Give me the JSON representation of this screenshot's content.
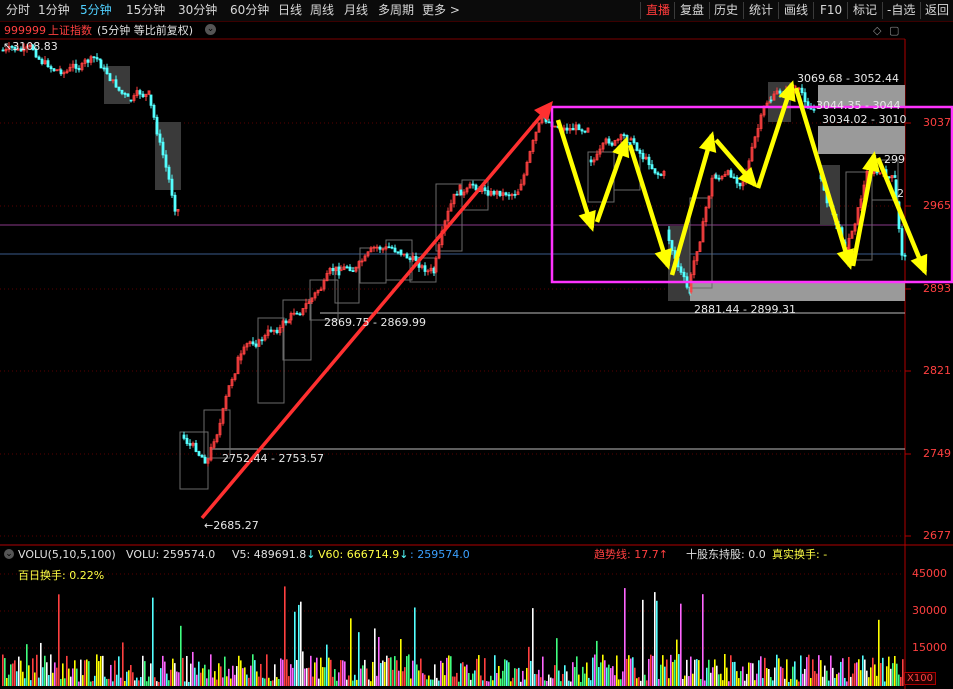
{
  "toolbar": {
    "tabs": [
      "分时",
      "1分钟",
      "5分钟",
      "15分钟",
      "30分钟",
      "60分钟",
      "日线",
      "周线",
      "月线",
      "多周期",
      "更多 >"
    ],
    "active_tab": "5分钟",
    "right": [
      "直播",
      "复盘",
      "历史",
      "统计",
      "画线",
      "F10",
      "标记",
      "-自选",
      "返回"
    ]
  },
  "title": {
    "code": "999999",
    "name": "上证指数",
    "mode": "(5分钟 等比前复权)"
  },
  "price_axis": [
    "3037",
    "2965",
    "2893",
    "2821",
    "2749",
    "2677"
  ],
  "annotations": {
    "high_left": "3108.83",
    "low": "2685.27",
    "zone_2752": "2752.44 - 2753.57",
    "zone_2869": "2869.75 - 2869.99",
    "zone_2881": "2881.44 - 2899.31",
    "zone_3069": "3069.68 - 3052.44",
    "zone_3044": "3044.35 - 3044",
    "zone_3034": "3034.02 - 3010",
    "right_299": "299",
    "right_2": "2"
  },
  "volume_panel": {
    "indicator": "VOLU(5,10,5,100)",
    "volu": "VOLU: 259574.0",
    "v5": "V5: 489691.8",
    "v60": "V60: 666714.9",
    "last": ": 259574.0",
    "trend": "趋势线: 17.7",
    "holders": "十股东持股: 0.0",
    "real_turnover": "真实换手: -",
    "turnover_100": "百日换手: 0.22%",
    "axis": [
      "45000",
      "30000",
      "15000"
    ],
    "unit": "X100"
  },
  "colors": {
    "up": "#ff4040",
    "down": "#54ffff",
    "arrow_red": "#ff3030",
    "arrow_yellow": "#ffff00",
    "box_magenta": "#ff33ff",
    "zone_gray": "#9a9a9a"
  }
}
